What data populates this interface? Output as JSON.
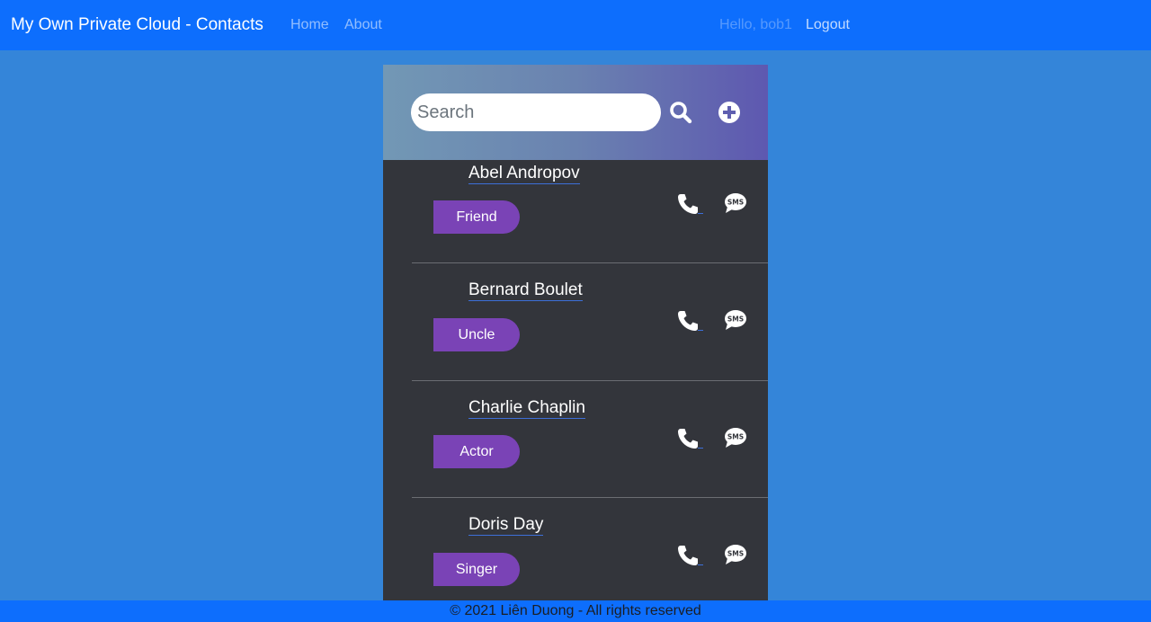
{
  "navbar": {
    "brand": "My Own Private Cloud - Contacts",
    "links": {
      "home": "Home",
      "about": "About"
    },
    "greeting": "Hello, bob1",
    "logout": "Logout"
  },
  "search": {
    "placeholder": "Search",
    "value": ""
  },
  "icons": {
    "search": "search-icon",
    "add": "plus-circle-icon",
    "call": "phone-icon",
    "sms": "sms-icon"
  },
  "contacts": [
    {
      "name": "Abel Andropov",
      "tag": "Friend"
    },
    {
      "name": "Bernard Boulet",
      "tag": "Uncle"
    },
    {
      "name": "Charlie Chaplin",
      "tag": "Actor"
    },
    {
      "name": "Doris Day",
      "tag": "Singer"
    }
  ],
  "footer": {
    "text": "© 2021 Liên Duong - All rights reserved"
  },
  "colors": {
    "background": "#3485d9",
    "navbar": "#0d6efd",
    "panel": "#33353b",
    "tag": "#7a43b6"
  }
}
